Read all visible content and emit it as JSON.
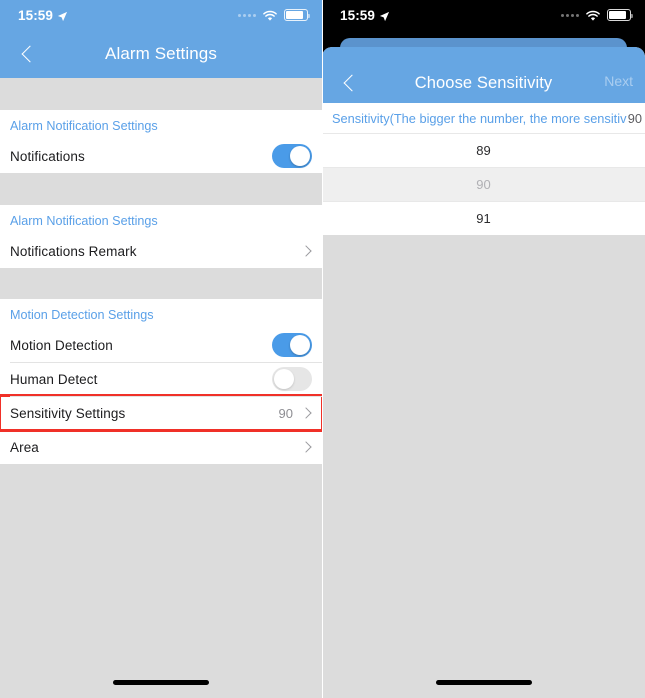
{
  "status_bar": {
    "time": "15:59",
    "location_icon": "location-arrow-icon",
    "signal_icon": "signal-dots-icon",
    "wifi_icon": "wifi-icon",
    "battery_icon": "battery-icon"
  },
  "colors": {
    "nav_blue": "#66a6e3",
    "card_behind_blue": "#5b93cd",
    "accent_blue": "#5aa0e8",
    "toggle_on": "#4a9be8",
    "toggle_off": "#e6e6e6",
    "highlight_red": "#f03028",
    "page_gray": "#dcdcdc",
    "selected_row_gray": "#efefef"
  },
  "left_screen": {
    "nav": {
      "back_icon": "chevron-left-icon",
      "title": "Alarm Settings"
    },
    "groups": [
      {
        "header": "Alarm Notification Settings",
        "rows": [
          {
            "label": "Notifications",
            "type": "toggle",
            "toggle_state": "on"
          }
        ]
      },
      {
        "header": "Alarm Notification Settings",
        "rows": [
          {
            "label": "Notifications Remark",
            "type": "disclosure",
            "value": "",
            "chevron_icon": "chevron-right-icon"
          }
        ]
      },
      {
        "header": "Motion Detection Settings",
        "rows": [
          {
            "label": "Motion Detection",
            "type": "toggle",
            "toggle_state": "on"
          },
          {
            "label": "Human Detect",
            "type": "toggle",
            "toggle_state": "off"
          },
          {
            "label": "Sensitivity Settings",
            "type": "disclosure",
            "value": "90",
            "chevron_icon": "chevron-right-icon",
            "highlighted": true
          },
          {
            "label": "Area",
            "type": "disclosure",
            "value": "",
            "chevron_icon": "chevron-right-icon"
          }
        ]
      }
    ]
  },
  "right_screen": {
    "nav": {
      "back_icon": "chevron-left-icon",
      "title": "Choose Sensitivity",
      "action_label": "Next"
    },
    "picker": {
      "header_text": "Sensitivity(The bigger the number, the more sensitiv",
      "header_value": "90",
      "options": [
        {
          "label": "89",
          "selected": false
        },
        {
          "label": "90",
          "selected": true
        },
        {
          "label": "91",
          "selected": false
        }
      ]
    }
  }
}
